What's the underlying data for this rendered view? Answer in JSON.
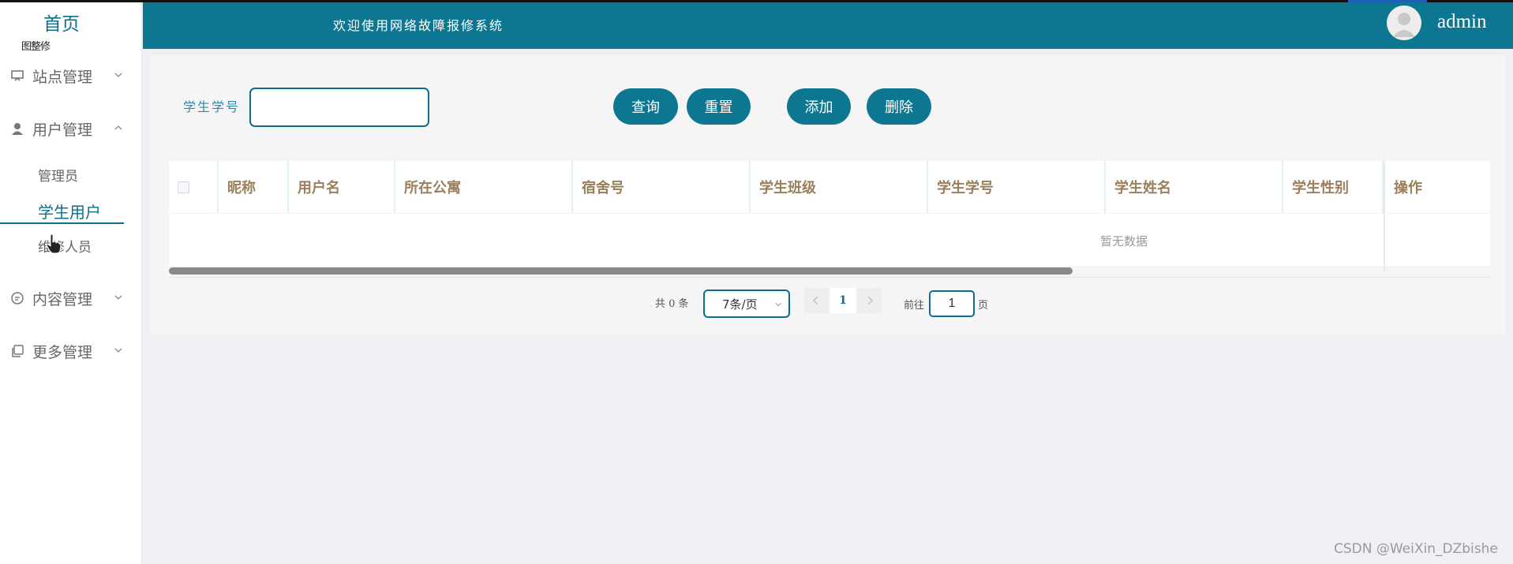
{
  "sidebar": {
    "home": "首页",
    "sub_title": "图整修",
    "menus": [
      {
        "label": "站点管理",
        "icon": "monitor-icon"
      },
      {
        "label": "用户管理",
        "icon": "user-icon"
      },
      {
        "label": "内容管理",
        "icon": "chat-icon"
      },
      {
        "label": "更多管理",
        "icon": "copy-icon"
      }
    ],
    "sub_items": [
      "管理员",
      "学生用户",
      "维修人员"
    ]
  },
  "header": {
    "welcome": "欢迎使用网络故障报修系统",
    "username": "admin"
  },
  "search": {
    "label": "学生学号",
    "value": "",
    "query_button": "查询",
    "reset_button": "重置",
    "add_button": "添加",
    "delete_button": "删除"
  },
  "table": {
    "columns": [
      "昵称",
      "用户名",
      "所在公寓",
      "宿舍号",
      "学生班级",
      "学生学号",
      "学生姓名",
      "学生性别",
      "操作"
    ],
    "empty_text": "暂无数据"
  },
  "pagination": {
    "total": "共 0 条",
    "page_size": "7条/页",
    "current_page": "1",
    "goto_label": "前往",
    "goto_value": "1",
    "page_suffix": "页"
  },
  "watermark": "CSDN @WeiXin_DZbishe",
  "colors": {
    "accent": "#0d7791",
    "header_text": "#9a7f5a"
  }
}
